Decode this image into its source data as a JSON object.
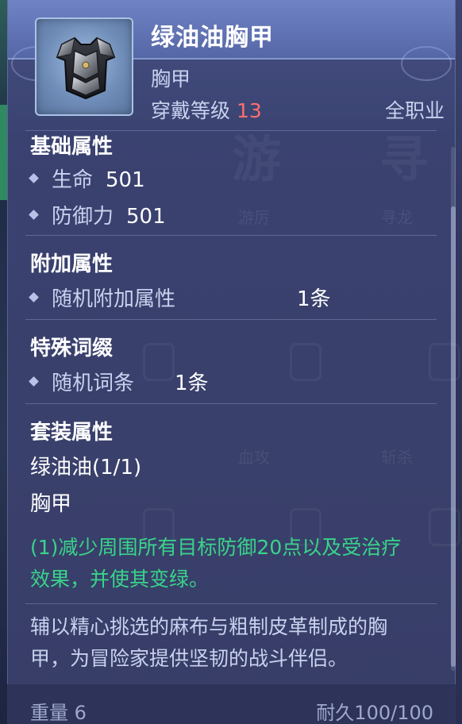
{
  "item": {
    "name": "绿油油胸甲",
    "type": "胸甲",
    "level_label": "穿戴等级",
    "level_value": "13",
    "class_label": "全职业",
    "icon": "chest-armor-icon"
  },
  "sections": {
    "basic": {
      "title": "基础属性",
      "attrs": [
        {
          "name": "生命",
          "value": "501"
        },
        {
          "name": "防御力",
          "value": "501"
        }
      ]
    },
    "extra": {
      "title": "附加属性",
      "attrs": [
        {
          "name": "随机附加属性",
          "value": "1条"
        }
      ]
    },
    "affix": {
      "title": "特殊词缀",
      "attrs": [
        {
          "name": "随机词条",
          "value": "1条"
        }
      ]
    },
    "set": {
      "title": "套装属性",
      "set_name": "绿油油(1/1)",
      "piece": "胸甲",
      "bonus_line1": "(1)减少周围所有目标防御20点以及受治疗",
      "bonus_line2": "效果，并使其变绿。"
    }
  },
  "description": {
    "line1": "辅以精心挑选的麻布与粗制皮革制成的胸",
    "line2": "甲，为冒险家提供坚韧的战斗伴侣。"
  },
  "footer": {
    "weight_label": "重量",
    "weight_value": "6",
    "durability_label": "耐久",
    "durability_value": "100/100"
  },
  "background": {
    "glyph1": "游",
    "glyph2": "寻",
    "label1": "游厉",
    "label2": "寻龙",
    "label3": "血攻",
    "label4": "斩杀"
  },
  "colors": {
    "level_value": "#ff6f6f",
    "set_bonus": "#39d48a"
  }
}
